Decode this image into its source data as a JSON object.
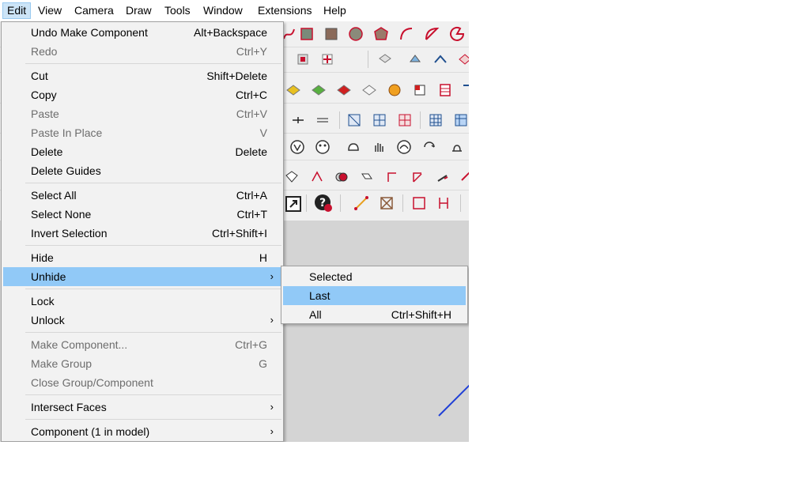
{
  "menubar": {
    "items": [
      {
        "label": "Edit"
      },
      {
        "label": "View"
      },
      {
        "label": "Camera"
      },
      {
        "label": "Draw"
      },
      {
        "label": "Tools"
      },
      {
        "label": "Window"
      },
      {
        "label": "Extensions"
      },
      {
        "label": "Help"
      }
    ]
  },
  "edit_menu": {
    "items": [
      {
        "label": "Undo Make Component",
        "shortcut": "Alt+Backspace"
      },
      {
        "label": "Redo",
        "shortcut": "Ctrl+Y"
      },
      {
        "label": "Cut",
        "shortcut": "Shift+Delete"
      },
      {
        "label": "Copy",
        "shortcut": "Ctrl+C"
      },
      {
        "label": "Paste",
        "shortcut": "Ctrl+V"
      },
      {
        "label": "Paste In Place",
        "shortcut": "V"
      },
      {
        "label": "Delete",
        "shortcut": "Delete"
      },
      {
        "label": "Delete Guides",
        "shortcut": ""
      },
      {
        "label": "Select All",
        "shortcut": "Ctrl+A"
      },
      {
        "label": "Select None",
        "shortcut": "Ctrl+T"
      },
      {
        "label": "Invert Selection",
        "shortcut": "Ctrl+Shift+I"
      },
      {
        "label": "Hide",
        "shortcut": "H"
      },
      {
        "label": "Unhide",
        "shortcut": "›"
      },
      {
        "label": "Lock",
        "shortcut": ""
      },
      {
        "label": "Unlock",
        "shortcut": "›"
      },
      {
        "label": "Make Component...",
        "shortcut": "Ctrl+G"
      },
      {
        "label": "Make Group",
        "shortcut": "G"
      },
      {
        "label": "Close Group/Component",
        "shortcut": ""
      },
      {
        "label": "Intersect Faces",
        "shortcut": "›"
      },
      {
        "label": "Component (1 in model)",
        "shortcut": "›"
      }
    ]
  },
  "unhide_submenu": {
    "items": [
      {
        "label": "Selected",
        "shortcut": ""
      },
      {
        "label": "Last",
        "shortcut": ""
      },
      {
        "label": "All",
        "shortcut": "Ctrl+Shift+H"
      }
    ]
  },
  "colors": {
    "highlight": "#91c9f7",
    "menu_bg": "#f2f2f2",
    "axis_blue": "#1f3fd6",
    "icon_red": "#c8102e"
  }
}
